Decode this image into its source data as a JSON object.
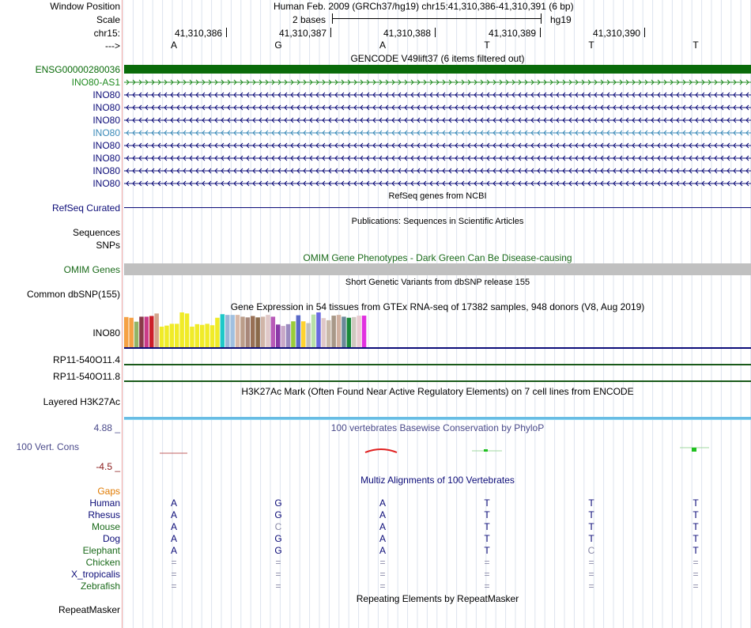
{
  "header": {
    "window_position_label": "Window Position",
    "scale_label": "Scale",
    "chrom_label": "chr15:",
    "strand_label": "--->",
    "assembly_title": "Human Feb. 2009 (GRCh37/hg19)   chr15:41,310,386-41,310,391 (6 bp)",
    "scale_text": "2 bases",
    "scale_assembly": "hg19",
    "positions": [
      "41,310,386",
      "41,310,387",
      "41,310,388",
      "41,310,389",
      "41,310,390"
    ],
    "sequence": [
      "A",
      "G",
      "A",
      "T",
      "T",
      "T"
    ]
  },
  "gencode": {
    "title": "GENCODE V49lift37 (6 items filtered out)",
    "tracks": [
      {
        "label": "ENSG00000280036",
        "style": "solid",
        "color": "#0a6b0a"
      },
      {
        "label": "INO80-AS1",
        "style": "forward",
        "color": "#1f8a1f"
      },
      {
        "label": "INO80",
        "style": "reverse",
        "color": "#0c0c78"
      },
      {
        "label": "INO80",
        "style": "reverse",
        "color": "#0c0c78"
      },
      {
        "label": "INO80",
        "style": "reverse",
        "color": "#0c0c78"
      },
      {
        "label": "INO80",
        "style": "reverse",
        "color": "#3a8ab8"
      },
      {
        "label": "INO80",
        "style": "reverse",
        "color": "#0c0c78"
      },
      {
        "label": "INO80",
        "style": "reverse",
        "color": "#0c0c78"
      },
      {
        "label": "INO80",
        "style": "reverse",
        "color": "#0c0c78"
      },
      {
        "label": "INO80",
        "style": "reverse",
        "color": "#0c0c78"
      }
    ]
  },
  "refseq": {
    "title": "RefSeq genes from NCBI",
    "label": "RefSeq Curated"
  },
  "publications": {
    "title": "Publications: Sequences in Scientific Articles",
    "label1": "Sequences",
    "label2": "SNPs"
  },
  "omim": {
    "title": "OMIM Gene Phenotypes - Dark Green Can Be Disease-causing",
    "label": "OMIM Genes"
  },
  "dbsnp": {
    "title": "Short Genetic Variants from dbSNP release 155",
    "label": "Common dbSNP(155)"
  },
  "gtex": {
    "title": "Gene Expression in 54 tissues from GTEx RNA-seq of 17382 samples, 948 donors (V8, Aug 2019)",
    "label": "INO80",
    "label2": "RP11-540O11.4",
    "label3": "RP11-540O11.8",
    "bar_levels": [
      0.87,
      0.85,
      0.74,
      0.88,
      0.88,
      0.9,
      0.97,
      0.6,
      0.63,
      0.68,
      0.68,
      1.0,
      0.97,
      0.6,
      0.67,
      0.65,
      0.68,
      0.64,
      0.85,
      0.95,
      0.93,
      0.93,
      0.93,
      0.88,
      0.86,
      0.9,
      0.86,
      0.88,
      0.93,
      0.88,
      0.66,
      0.62,
      0.67,
      0.75,
      0.92,
      0.75,
      0.7,
      0.94,
      1.0,
      0.84,
      0.78,
      0.91,
      0.93,
      0.88,
      0.85,
      0.87,
      0.91,
      0.91,
      0.88,
      0.5
    ],
    "bar_colors": [
      "#f5a144",
      "#f5a144",
      "#92b466",
      "#8a3a4a",
      "#c93b88",
      "#cc1f2a",
      "#d4a48c",
      "#f0eb28",
      "#f0eb28",
      "#f0eb28",
      "#f0eb28",
      "#f0eb28",
      "#f0eb28",
      "#f0eb28",
      "#f0eb28",
      "#f0eb28",
      "#f0eb28",
      "#f0eb28",
      "#f0eb28",
      "#1fc8c8",
      "#9cb5d6",
      "#a0c0e0",
      "#d8b8a8",
      "#bb9d8a",
      "#a8877a",
      "#987055",
      "#8a6a4a",
      "#d0b5a8",
      "#e0c8c8",
      "#b85ab8",
      "#8a3aa8",
      "#c8a8c8",
      "#9a8ac0",
      "#9acc3a",
      "#5a6ac8",
      "#ffd330",
      "#bfbfbf",
      "#b8e0a8",
      "#6a6ae0",
      "#e0c8c8",
      "#c8b8a8",
      "#a89888",
      "#d0b0a0",
      "#6a8a9a",
      "#1a8a3a",
      "#d0c8c0",
      "#e8cbd0",
      "#e030e0",
      "#bfbfbf",
      "#b4b4b4"
    ]
  },
  "h3k27ac": {
    "title": "H3K27Ac Mark (Often Found Near Active Regulatory Elements) on 7 cell lines from ENCODE",
    "label": "Layered H3K27Ac"
  },
  "phylop": {
    "title": "100 vertebrates Basewise Conservation by PhyloP",
    "label": "100 Vert. Cons",
    "max_label": "4.88 _",
    "min_label": "-4.5 _"
  },
  "multiz": {
    "title": "Multiz Alignments of 100 Vertebrates",
    "gaps_label": "Gaps",
    "species": [
      {
        "name": "Human",
        "bases": [
          "A",
          "G",
          "A",
          "T",
          "T",
          "T"
        ]
      },
      {
        "name": "Rhesus",
        "bases": [
          "A",
          "G",
          "A",
          "T",
          "T",
          "T"
        ]
      },
      {
        "name": "Mouse",
        "bases": [
          "A",
          "C",
          "A",
          "T",
          "T",
          "T"
        ]
      },
      {
        "name": "Dog",
        "bases": [
          "A",
          "G",
          "A",
          "T",
          "T",
          "T"
        ]
      },
      {
        "name": "Elephant",
        "bases": [
          "A",
          "G",
          "A",
          "T",
          "C",
          "T"
        ]
      },
      {
        "name": "Chicken",
        "bases": [
          "=",
          "=",
          "=",
          "=",
          "=",
          "="
        ]
      },
      {
        "name": "X_tropicalis",
        "bases": [
          "=",
          "=",
          "=",
          "=",
          "=",
          "="
        ]
      },
      {
        "name": "Zebrafish",
        "bases": [
          "=",
          "=",
          "=",
          "=",
          "=",
          "="
        ]
      }
    ]
  },
  "repeatmasker": {
    "title": "Repeating Elements by RepeatMasker",
    "label": "RepeatMasker"
  },
  "colors": {
    "gencode_green": "#0a6b0a",
    "omim_gray": "#c0c0c0",
    "phylop_blue": "#4a4a8a",
    "phylop_red": "#8a1a1a",
    "gaps_orange": "#e07a00",
    "navy": "#0c0c78"
  }
}
